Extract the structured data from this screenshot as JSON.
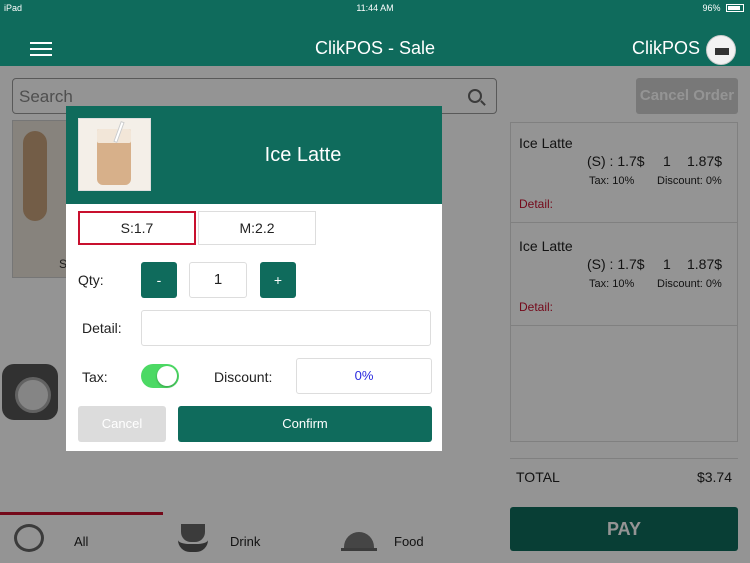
{
  "status_bar": {
    "device": "iPad",
    "time": "11:44 AM",
    "battery": "96%"
  },
  "header": {
    "title": "ClikPOS - Sale",
    "brand": "ClikPOS"
  },
  "search": {
    "placeholder": "Search"
  },
  "cancel_order_label": "Cancel Order",
  "product_card_label": "S",
  "order": {
    "items": [
      {
        "name": "Ice Latte",
        "size": "(S) : 1.7$",
        "qty": "1",
        "price": "1.87$",
        "tax": "Tax: 10%",
        "discount": "Discount: 0%",
        "detail": "Detail:"
      },
      {
        "name": "Ice Latte",
        "size": "(S) : 1.7$",
        "qty": "1",
        "price": "1.87$",
        "tax": "Tax: 10%",
        "discount": "Discount: 0%",
        "detail": "Detail:"
      }
    ],
    "total_label": "TOTAL",
    "total_value": "$3.74"
  },
  "pay_label": "PAY",
  "tabs": [
    {
      "label": "All",
      "icon": "plate-icon"
    },
    {
      "label": "Drink",
      "icon": "coffee-cup-icon"
    },
    {
      "label": "Food",
      "icon": "cloche-icon"
    }
  ],
  "modal": {
    "title": "Ice Latte",
    "sizes": [
      "S:1.7",
      "M:2.2"
    ],
    "selected_size": "S:1.7",
    "qty_label": "Qty:",
    "minus": "-",
    "plus": "+",
    "qty_value": "1",
    "detail_label": "Detail:",
    "detail_value": "",
    "tax_label": "Tax:",
    "tax_enabled": true,
    "discount_label": "Discount:",
    "discount_value": "0%",
    "cancel_label": "Cancel",
    "confirm_label": "Confirm"
  },
  "colors": {
    "primary": "#0f6b5c",
    "accent_red": "#c8102e",
    "toggle_on": "#4cd964"
  }
}
